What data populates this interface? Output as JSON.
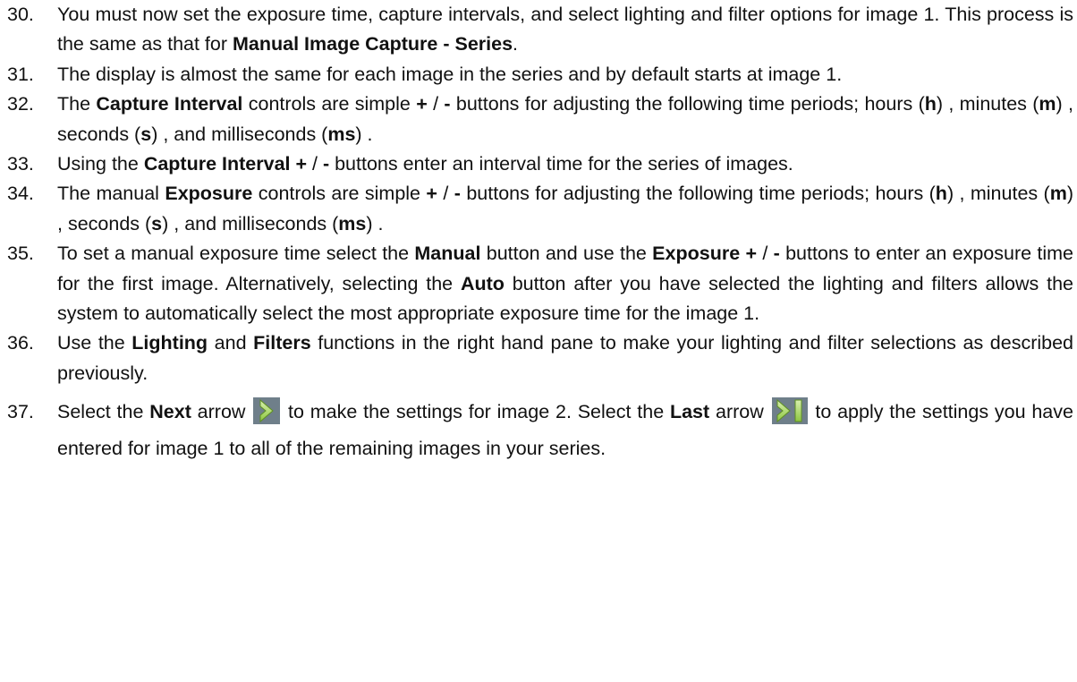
{
  "steps": [
    {
      "number": "30.",
      "parts": [
        {
          "t": "You must now set the exposure time, capture intervals, and select lighting and filter options for image 1. This process is the same as that for "
        },
        {
          "b": "Manual Image Capture - Series"
        },
        {
          "t": "."
        }
      ]
    },
    {
      "number": "31.",
      "parts": [
        {
          "t": "The display is almost the same for each image in the series and by default starts at image 1."
        }
      ]
    },
    {
      "number": "32.",
      "parts": [
        {
          "t": "The "
        },
        {
          "b": "Capture Interval"
        },
        {
          "t": " controls are simple "
        },
        {
          "b": "+"
        },
        {
          "t": " / "
        },
        {
          "b": "-"
        },
        {
          "t": " buttons for adjusting the following time periods; hours ("
        },
        {
          "b": "h"
        },
        {
          "t": ") , minutes ("
        },
        {
          "b": "m"
        },
        {
          "t": ") , seconds ("
        },
        {
          "b": "s"
        },
        {
          "t": ") , and milliseconds ("
        },
        {
          "b": "ms"
        },
        {
          "t": ") ."
        }
      ]
    },
    {
      "number": "33.",
      "parts": [
        {
          "t": "Using the "
        },
        {
          "b": "Capture Interval +"
        },
        {
          "t": " / "
        },
        {
          "b": "-"
        },
        {
          "t": " buttons enter an interval time for the series of images."
        }
      ]
    },
    {
      "number": "34.",
      "parts": [
        {
          "t": "The manual "
        },
        {
          "b": "Exposure"
        },
        {
          "t": " controls are simple "
        },
        {
          "b": "+"
        },
        {
          "t": " / "
        },
        {
          "b": "-"
        },
        {
          "t": " buttons for adjusting the following time periods; hours ("
        },
        {
          "b": "h"
        },
        {
          "t": ") , minutes ("
        },
        {
          "b": "m"
        },
        {
          "t": ") , seconds ("
        },
        {
          "b": "s"
        },
        {
          "t": ") , and milliseconds ("
        },
        {
          "b": "ms"
        },
        {
          "t": ") ."
        }
      ]
    },
    {
      "number": "35.",
      "parts": [
        {
          "t": "To set a manual exposure time select the "
        },
        {
          "b": "Manual"
        },
        {
          "t": " button and use the "
        },
        {
          "b": "Exposure +"
        },
        {
          "t": " / "
        },
        {
          "b": "-"
        },
        {
          "t": " buttons to enter an exposure time for the first image. Alternatively, selecting the "
        },
        {
          "b": "Auto"
        },
        {
          "t": " button after you have selected the lighting and filters allows the system to automatically select the most appropriate exposure time for the image 1."
        }
      ]
    },
    {
      "number": "36.",
      "parts": [
        {
          "t": "Use the "
        },
        {
          "b": "Lighting"
        },
        {
          "t": " and "
        },
        {
          "b": "Filters"
        },
        {
          "t": " functions in the right hand pane to make your lighting and filter selections as described previously."
        }
      ]
    },
    {
      "number": "37.",
      "parts": [
        {
          "t": "Select the "
        },
        {
          "b": "Next"
        },
        {
          "t": " arrow "
        },
        {
          "icon": "next-arrow-icon"
        },
        {
          "t": " to make the settings for image 2. Select the "
        },
        {
          "b": "Last"
        },
        {
          "t": " arrow "
        },
        {
          "icon": "last-arrow-icon"
        },
        {
          "t": " to apply the settings you have entered for image 1 to all of the remaining images in your series."
        }
      ]
    }
  ],
  "icons": {
    "next-arrow-icon": {
      "color": "#8DC63F",
      "bg": "#6F7F8A"
    },
    "last-arrow-icon": {
      "color": "#8DC63F",
      "bg": "#6F7F8A"
    }
  }
}
